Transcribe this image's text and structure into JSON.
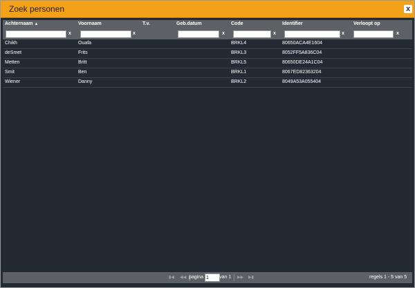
{
  "dialog": {
    "title": "Zoek personen",
    "close_label": "x"
  },
  "table": {
    "columns": [
      {
        "label": "Achternaam",
        "sorted": "ascending"
      },
      {
        "label": "Voornaam"
      },
      {
        "label": "T.v."
      },
      {
        "label": "Geb.datum"
      },
      {
        "label": "Code"
      },
      {
        "label": "Identifier"
      },
      {
        "label": "Verloopt op"
      }
    ],
    "filter_clear_label": "x",
    "rows": [
      {
        "achternaam": "Chikh",
        "voornaam": "Ouafa",
        "tv": "",
        "gebdatum": "",
        "code": "BRKL4",
        "identifier": "80650ACA4E1604",
        "verloopt": ""
      },
      {
        "achternaam": "deSmet",
        "voornaam": "Frits",
        "tv": "",
        "gebdatum": "",
        "code": "BRKL3",
        "identifier": "8052FF5A836C04",
        "verloopt": ""
      },
      {
        "achternaam": "Metten",
        "voornaam": "Britt",
        "tv": "",
        "gebdatum": "",
        "code": "BRKL5",
        "identifier": "80650DE24A1C04",
        "verloopt": ""
      },
      {
        "achternaam": "Smit",
        "voornaam": "Ben",
        "tv": "",
        "gebdatum": "",
        "code": "BRKL1",
        "identifier": "8067ED82363204",
        "verloopt": ""
      },
      {
        "achternaam": "Wiener",
        "voornaam": "Danny",
        "tv": "",
        "gebdatum": "",
        "code": "BRKL2",
        "identifier": "8049A53A055404",
        "verloopt": ""
      }
    ]
  },
  "pager": {
    "page_label": "pagina",
    "page_value": "1",
    "of_label": "van 1",
    "records_text": "regels 1 - 5 van 5"
  }
}
